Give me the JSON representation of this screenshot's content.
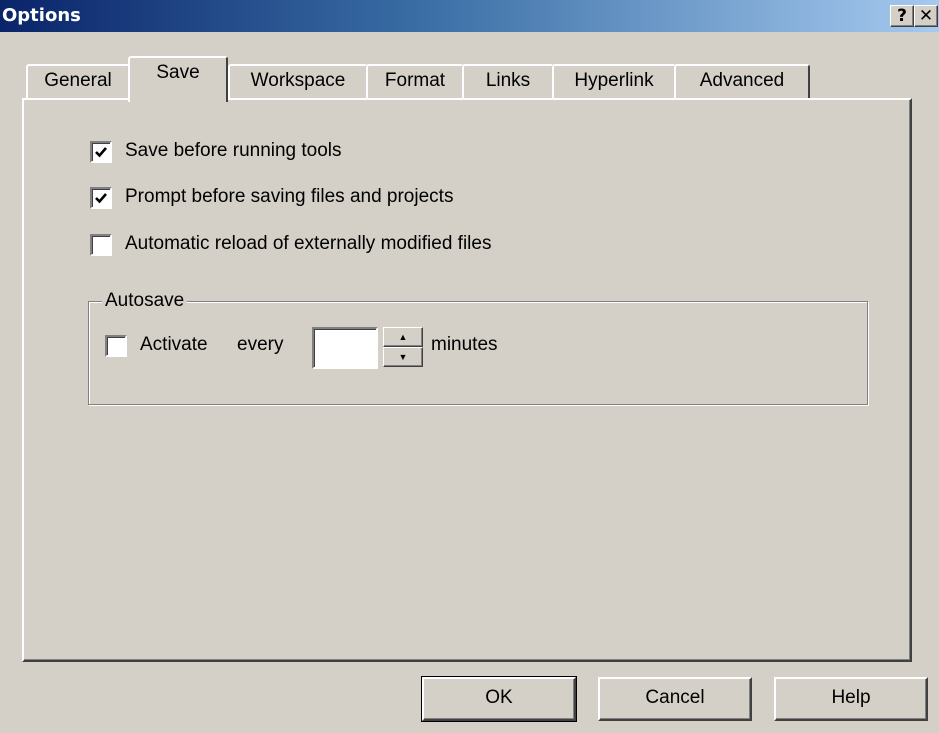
{
  "window": {
    "title": "Options",
    "help_glyph": "?",
    "close_glyph": "✕"
  },
  "tabs": [
    {
      "label": "General"
    },
    {
      "label": "Save"
    },
    {
      "label": "Workspace"
    },
    {
      "label": "Format"
    },
    {
      "label": "Links"
    },
    {
      "label": "Hyperlink"
    },
    {
      "label": "Advanced"
    }
  ],
  "active_tab": "Save",
  "save": {
    "options": [
      {
        "label": "Save before running tools",
        "checked": true
      },
      {
        "label": "Prompt before saving files and projects",
        "checked": true
      },
      {
        "label": "Automatic reload of externally modified files",
        "checked": false
      }
    ],
    "autosave": {
      "group_title": "Autosave",
      "activate_label": "Activate",
      "activate_checked": false,
      "every_label": "every",
      "minutes_value": "",
      "minutes_label": "minutes",
      "spin_up_glyph": "▲",
      "spin_down_glyph": "▼"
    }
  },
  "buttons": {
    "ok": "OK",
    "cancel": "Cancel",
    "help": "Help"
  },
  "colors": {
    "face": "#d4d0c8",
    "title_start": "#0a246a",
    "title_end": "#a6caf0"
  }
}
